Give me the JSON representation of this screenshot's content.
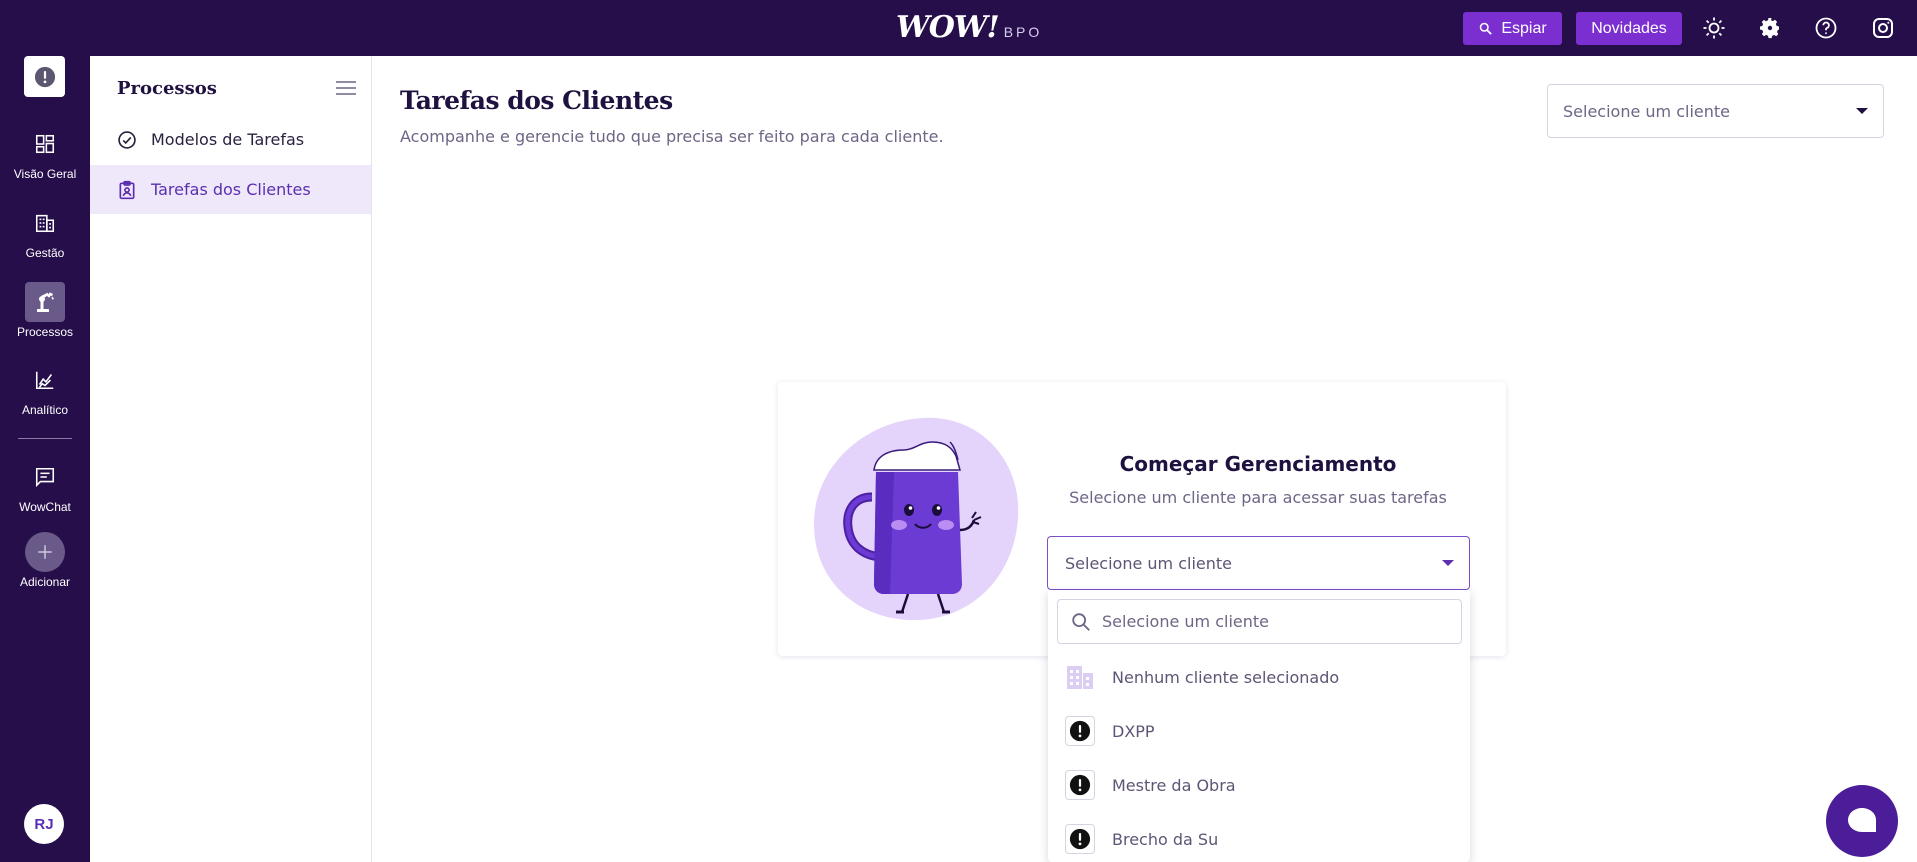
{
  "topbar": {
    "logo_main": "WOW!",
    "logo_sub": "BPO",
    "espiar_label": "Espiar",
    "novidades_label": "Novidades",
    "icons": [
      "sun-icon",
      "gear-icon",
      "help-icon",
      "instagram-icon"
    ]
  },
  "rail": {
    "items": [
      {
        "label": "Visão Geral",
        "icon": "grid-icon"
      },
      {
        "label": "Gestão",
        "icon": "building-icon"
      },
      {
        "label": "Processos",
        "icon": "robot-arm-icon",
        "active": true
      },
      {
        "label": "Analítico",
        "icon": "chart-icon"
      },
      {
        "label": "WowChat",
        "icon": "chat-icon"
      },
      {
        "label": "Adicionar",
        "icon": "plus-icon"
      }
    ],
    "avatar_initials": "RJ"
  },
  "sidebar": {
    "title": "Processos",
    "items": [
      {
        "label": "Modelos de Tarefas",
        "icon": "check-circle-icon"
      },
      {
        "label": "Tarefas dos Clientes",
        "icon": "clipboard-user-icon",
        "active": true
      }
    ]
  },
  "main": {
    "title": "Tarefas dos Clientes",
    "subtitle": "Acompanhe e gerencie tudo que precisa ser feito para cada cliente.",
    "client_select_placeholder": "Selecione um cliente"
  },
  "card": {
    "title": "Começar Gerenciamento",
    "subtitle": "Selecione um cliente para acessar suas tarefas",
    "select_placeholder": "Selecione um cliente"
  },
  "dropdown": {
    "search_placeholder": "Selecione um cliente",
    "options": [
      {
        "label": "Nenhum cliente selecionado",
        "icon": "building-icon"
      },
      {
        "label": "DXPP",
        "icon": "alert-icon"
      },
      {
        "label": "Mestre da Obra",
        "icon": "alert-icon"
      },
      {
        "label": "Brecho da Su",
        "icon": "alert-icon"
      }
    ]
  },
  "colors": {
    "nav_bg": "#250e4a",
    "accent": "#7b2fd1",
    "active_bg": "#efe7fa",
    "fab": "#4b1d98"
  }
}
